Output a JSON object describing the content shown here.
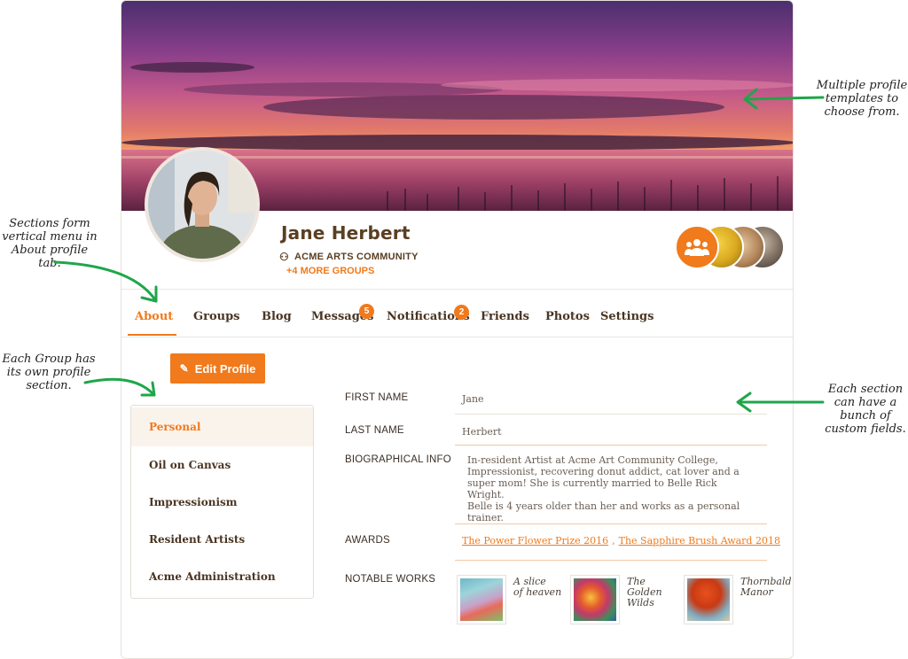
{
  "annotations": {
    "templates": [
      "Multiple profile",
      "templates to",
      "choose from."
    ],
    "sections_menu": [
      "Sections form",
      "vertical menu in",
      "About profile tab."
    ],
    "group_section": [
      "Each Group has",
      "its own profile",
      "section."
    ],
    "custom_fields": [
      "Each section",
      "can have a",
      "bunch of",
      "custom fields."
    ]
  },
  "profile": {
    "name": "Jane Herbert",
    "community": "ACME ARTS COMMUNITY",
    "more_groups": "+4 MORE GROUPS"
  },
  "tabs": [
    {
      "label": "About",
      "active": true
    },
    {
      "label": "Groups"
    },
    {
      "label": "Blog"
    },
    {
      "label": "Messages",
      "badge": "5"
    },
    {
      "label": "Notifications",
      "badge": "2"
    },
    {
      "label": "Friends"
    },
    {
      "label": "Photos"
    },
    {
      "label": "Settings"
    }
  ],
  "edit_button": "Edit Profile",
  "sections": [
    {
      "label": "Personal",
      "active": true
    },
    {
      "label": "Oil on Canvas"
    },
    {
      "label": "Impressionism"
    },
    {
      "label": "Resident Artists"
    },
    {
      "label": "Acme Administration"
    }
  ],
  "fields": {
    "first_name": {
      "label": "FIRST NAME",
      "value": "Jane"
    },
    "last_name": {
      "label": "LAST NAME",
      "value": "Herbert"
    },
    "bio": {
      "label": "BIOGRAPHICAL INFO",
      "lines": [
        "In-resident Artist at Acme Art Community College,",
        "Impressionist, recovering donut addict, cat lover and a",
        "super mom! She is currently married to Belle Rick Wright.",
        "Belle is 4 years older than her and works as a personal",
        "trainer."
      ]
    },
    "awards": {
      "label": "AWARDS",
      "items": [
        "The Power Flower Prize 2016",
        "The Sapphire Brush Award 2018"
      ],
      "separator": ","
    },
    "notable_works": {
      "label": "NOTABLE WORKS",
      "items": [
        {
          "title_lines": [
            "A slice",
            "of heaven"
          ]
        },
        {
          "title_lines": [
            "The Golden",
            "Wilds"
          ]
        },
        {
          "title_lines": [
            "Thornbald",
            "Manor"
          ]
        }
      ]
    }
  },
  "colors": {
    "accent": "#f07a1c",
    "brown_text": "#5a3f22",
    "annotation_arrow": "#1fa64a"
  }
}
